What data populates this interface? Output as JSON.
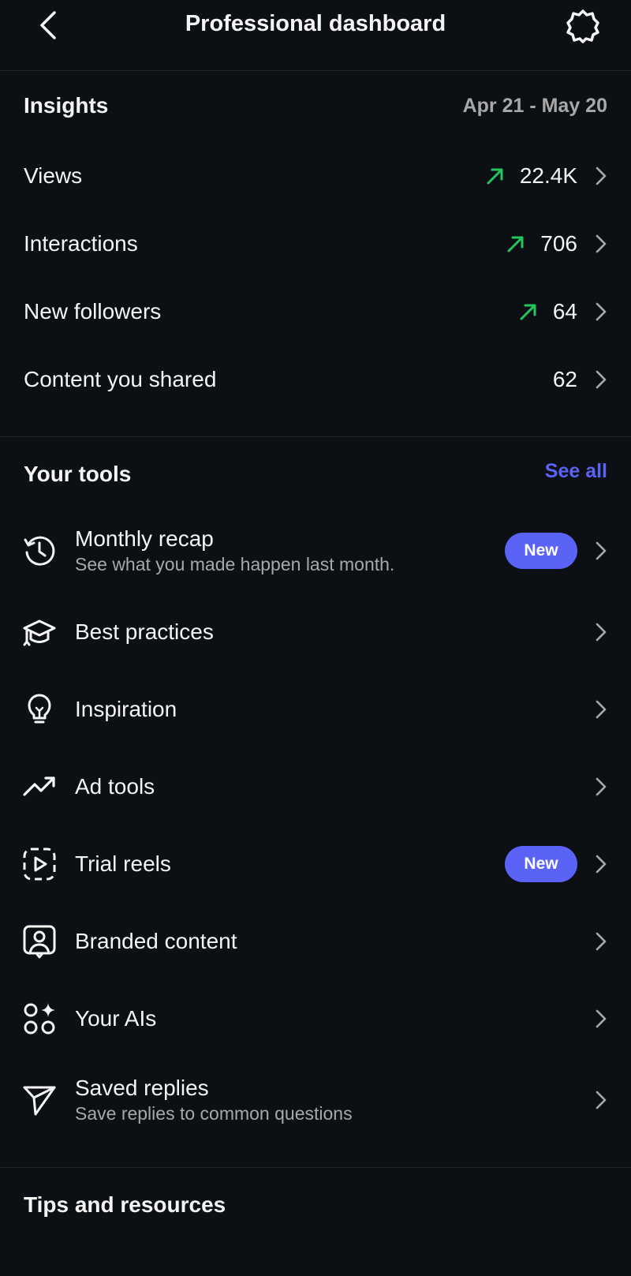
{
  "header": {
    "title": "Professional dashboard",
    "back_icon": "chevron-left-icon",
    "settings_icon": "gear-icon"
  },
  "insights": {
    "title": "Insights",
    "date_range": "Apr 21 - May 20",
    "trend_color": "#22c55e",
    "metrics": [
      {
        "label": "Views",
        "value": "22.4K",
        "trend": "up"
      },
      {
        "label": "Interactions",
        "value": "706",
        "trend": "up"
      },
      {
        "label": "New followers",
        "value": "64",
        "trend": "up"
      },
      {
        "label": "Content you shared",
        "value": "62",
        "trend": "none"
      }
    ]
  },
  "tools": {
    "title": "Your tools",
    "see_all": "See all",
    "accent": "#5b63f6",
    "items": [
      {
        "title": "Monthly recap",
        "subtitle": "See what you made happen last month.",
        "badge": "New",
        "icon": "history-icon"
      },
      {
        "title": "Best practices",
        "subtitle": "",
        "badge": "",
        "icon": "graduation-cap-icon"
      },
      {
        "title": "Inspiration",
        "subtitle": "",
        "badge": "",
        "icon": "lightbulb-icon"
      },
      {
        "title": "Ad tools",
        "subtitle": "",
        "badge": "",
        "icon": "trending-up-icon"
      },
      {
        "title": "Trial reels",
        "subtitle": "",
        "badge": "New",
        "icon": "trial-reels-icon"
      },
      {
        "title": "Branded content",
        "subtitle": "",
        "badge": "",
        "icon": "branded-content-icon"
      },
      {
        "title": "Your AIs",
        "subtitle": "",
        "badge": "",
        "icon": "ai-sparkle-icon"
      },
      {
        "title": "Saved replies",
        "subtitle": "Save replies to common questions",
        "badge": "",
        "icon": "paper-plane-icon"
      }
    ]
  },
  "tips": {
    "title": "Tips and resources"
  }
}
